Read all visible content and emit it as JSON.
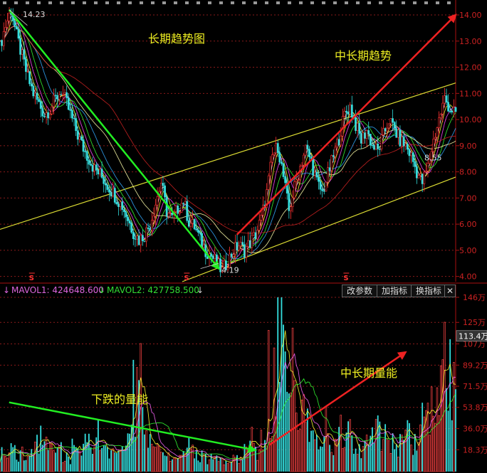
{
  "chart_data": [
    {
      "type": "line",
      "name_label": "price-chart",
      "annotation_title": "长期趋势图",
      "annotation_mid": "中长期趋势",
      "high_label": "14.23",
      "low_label": "4.19",
      "ma_label": "8.55",
      "ylim": [
        3.8,
        14.3
      ],
      "y_ticks": [
        "14.00",
        "13.00",
        "12.00",
        "11.00",
        "10.00",
        "9.00",
        "8.00",
        "7.00",
        "6.00",
        "5.00",
        "4.00"
      ],
      "y_tick_values": [
        14,
        13,
        12,
        11,
        10,
        9,
        8,
        7,
        6,
        5,
        4
      ],
      "x_range": [
        0,
        100
      ],
      "close": [
        12.8,
        13.6,
        14.2,
        13.2,
        12.4,
        11.6,
        11.0,
        10.6,
        10.2,
        10.4,
        10.8,
        11.1,
        10.6,
        10.0,
        9.4,
        8.9,
        8.5,
        8.1,
        7.9,
        7.6,
        7.3,
        7.0,
        6.7,
        6.2,
        5.7,
        5.4,
        5.6,
        6.0,
        6.8,
        7.6,
        6.5,
        6.2,
        6.6,
        6.9,
        6.1,
        5.9,
        5.4,
        5.0,
        4.8,
        4.5,
        4.2,
        4.6,
        5.0,
        5.2,
        5.0,
        5.3,
        5.6,
        6.2,
        7.2,
        8.6,
        9.0,
        7.8,
        6.5,
        7.4,
        8.2,
        8.9,
        8.4,
        7.6,
        7.2,
        7.9,
        8.6,
        9.3,
        10.2,
        10.5,
        9.8,
        9.2,
        9.6,
        9.0,
        8.8,
        9.4,
        10.0,
        9.6,
        9.2,
        9.0,
        8.6,
        8.0,
        7.6,
        8.2,
        9.2,
        10.0,
        10.8,
        10.4,
        10.3
      ],
      "high_index": 2,
      "low_index": 40,
      "channel_lines": [
        {
          "x": [
            0,
            100
          ],
          "y": [
            5.8,
            11.4
          ],
          "color": "#dddd33"
        },
        {
          "x": [
            40,
            100
          ],
          "y": [
            3.8,
            7.8
          ],
          "color": "#dddd33"
        }
      ],
      "trend_down": {
        "x": [
          2,
          48
        ],
        "y": [
          14.2,
          4.3
        ],
        "color": "#22ee22"
      },
      "trend_up": {
        "x": [
          52,
          100
        ],
        "y": [
          5.6,
          14.0
        ],
        "color": "#ee2222"
      },
      "s_markers": [
        7,
        41,
        76
      ]
    },
    {
      "type": "bar",
      "name_label": "volume-chart",
      "annotation_down": "下跌的量能",
      "annotation_up": "中长期量能",
      "legend": [
        {
          "name": "MAVOL1: 424648.600",
          "color": "#dd66dd",
          "arrow": "↓"
        },
        {
          "name": "MAVOL2: 427758.500",
          "color": "#33dd33",
          "arrow": "↓"
        }
      ],
      "current_label": "113.4万",
      "ylim": [
        0,
        146
      ],
      "y_ticks": [
        "146万",
        "125万",
        "107万",
        "89.2万",
        "71.5万",
        "53.8万",
        "36.0万",
        "18.3万"
      ],
      "y_tick_values": [
        146,
        125,
        107,
        89.2,
        71.5,
        53.8,
        36.0,
        18.3
      ],
      "volume_profile": [
        18,
        22,
        20,
        16,
        14,
        24,
        30,
        26,
        20,
        14,
        12,
        22,
        34,
        28,
        20,
        18,
        16,
        14,
        22,
        40,
        86,
        30,
        20,
        16,
        14,
        12,
        18,
        22,
        14,
        16,
        12,
        14,
        12,
        10,
        12,
        18,
        20,
        16,
        40,
        70,
        146,
        50,
        56,
        60,
        42,
        36,
        30,
        26,
        34,
        40,
        30,
        24,
        22,
        36,
        40,
        30,
        28,
        26,
        34,
        30,
        36,
        44,
        70,
        125,
        90,
        60
      ],
      "trend_down": {
        "x": [
          2,
          56
        ],
        "y": [
          58,
          18
        ],
        "color": "#22ee22"
      },
      "trend_up": {
        "x": [
          59,
          89
        ],
        "y": [
          22,
          100
        ],
        "color": "#ee2222"
      }
    }
  ],
  "buttons": {
    "params": "改参数",
    "add_indicator": "加指标",
    "switch_indicator": "换指标",
    "close": "✕"
  },
  "colors": {
    "up": "#ff3333",
    "down": "#33dddd",
    "grid": "#8a1a1a",
    "axis": "#aa1111"
  }
}
